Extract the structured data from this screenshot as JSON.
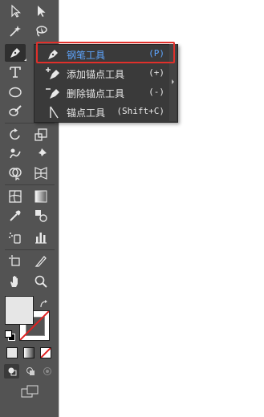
{
  "tools": {
    "selection": "selection-tool",
    "direct_selection": "direct-selection-tool",
    "magic_wand": "magic-wand-tool",
    "lasso": "lasso-tool",
    "pen": "pen-tool",
    "type": "type-tool",
    "ellipse": "ellipse-tool",
    "paintbrush": "paintbrush-tool",
    "rotate": "rotate-tool",
    "scale": "scale-tool",
    "warp": "warp-tool",
    "puppet_warp": "puppet-warp-tool",
    "shape_builder": "shape-builder-tool",
    "perspective_grid": "perspective-grid-tool",
    "mesh": "mesh-tool",
    "gradient": "gradient-tool",
    "eyedropper": "eyedropper-tool",
    "blend": "blend-tool",
    "symbol_sprayer": "symbol-sprayer-tool",
    "column_graph": "column-graph-tool",
    "artboard": "artboard-tool",
    "slice": "slice-tool",
    "hand": "hand-tool",
    "zoom": "zoom-tool"
  },
  "colors": {
    "toolbar_bg": "#535353",
    "flyout_bg": "#3a3a3a",
    "selected_text": "#5ea6ff",
    "highlight_border": "#e0302b",
    "fill_swatch": "#e6e6e6"
  },
  "flyout": {
    "items": [
      {
        "icon": "pen-icon",
        "label": "钢笔工具",
        "shortcut": "(P)",
        "selected": true
      },
      {
        "icon": "add-anchor-point-icon",
        "label": "添加锚点工具",
        "shortcut": "(+)",
        "selected": false
      },
      {
        "icon": "delete-anchor-point-icon",
        "label": "删除锚点工具",
        "shortcut": "(-)",
        "selected": false
      },
      {
        "icon": "anchor-point-icon",
        "label": "锚点工具",
        "shortcut": "(Shift+C)",
        "selected": false
      }
    ]
  }
}
